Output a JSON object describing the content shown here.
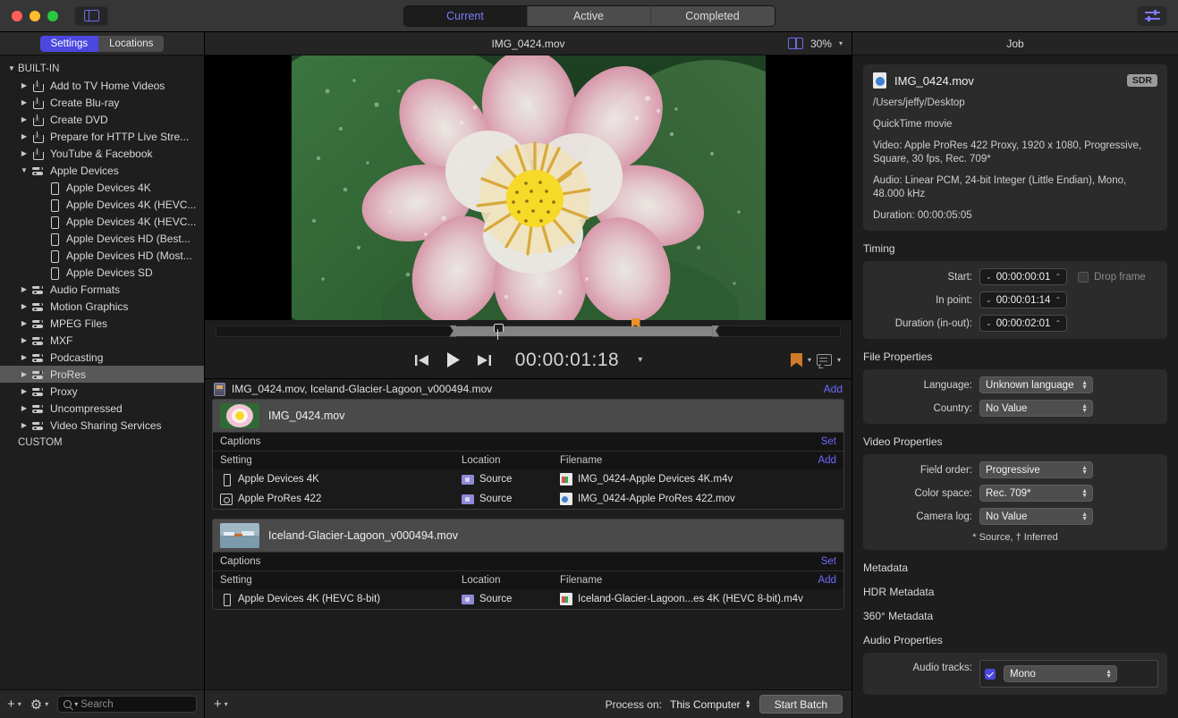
{
  "titlebar": {
    "sidebar_toggle_icon": "sidebar-panel-icon",
    "inspector_toggle_icon": "sliders-icon",
    "segments": [
      {
        "label": "Current",
        "active": true
      },
      {
        "label": "Active",
        "active": false
      },
      {
        "label": "Completed",
        "active": false
      }
    ]
  },
  "sidebar": {
    "tabs": [
      {
        "label": "Settings",
        "active": true
      },
      {
        "label": "Locations",
        "active": false
      }
    ],
    "tree": [
      {
        "label": "BUILT-IN",
        "level": 0,
        "twisty": "down",
        "icon": null,
        "selected": false
      },
      {
        "label": "Add to TV Home Videos",
        "level": 1,
        "twisty": "right",
        "icon": "share-icon",
        "selected": false
      },
      {
        "label": "Create Blu-ray",
        "level": 1,
        "twisty": "right",
        "icon": "share-icon",
        "selected": false
      },
      {
        "label": "Create DVD",
        "level": 1,
        "twisty": "right",
        "icon": "share-icon",
        "selected": false
      },
      {
        "label": "Prepare for HTTP Live Stre...",
        "level": 1,
        "twisty": "right",
        "icon": "share-icon",
        "selected": false
      },
      {
        "label": "YouTube & Facebook",
        "level": 1,
        "twisty": "right",
        "icon": "share-icon",
        "selected": false
      },
      {
        "label": "Apple Devices",
        "level": 1,
        "twisty": "down",
        "icon": "settings-group-icon",
        "selected": false
      },
      {
        "label": "Apple Devices 4K",
        "level": 2,
        "twisty": null,
        "icon": "device-icon",
        "selected": false
      },
      {
        "label": "Apple Devices 4K (HEVC...",
        "level": 2,
        "twisty": null,
        "icon": "device-icon",
        "selected": false
      },
      {
        "label": "Apple Devices 4K (HEVC...",
        "level": 2,
        "twisty": null,
        "icon": "device-icon",
        "selected": false
      },
      {
        "label": "Apple Devices HD (Best...",
        "level": 2,
        "twisty": null,
        "icon": "device-icon",
        "selected": false
      },
      {
        "label": "Apple Devices HD (Most...",
        "level": 2,
        "twisty": null,
        "icon": "device-icon",
        "selected": false
      },
      {
        "label": "Apple Devices SD",
        "level": 2,
        "twisty": null,
        "icon": "device-icon",
        "selected": false
      },
      {
        "label": "Audio Formats",
        "level": 1,
        "twisty": "right",
        "icon": "settings-group-icon",
        "selected": false
      },
      {
        "label": "Motion Graphics",
        "level": 1,
        "twisty": "right",
        "icon": "settings-group-icon",
        "selected": false
      },
      {
        "label": "MPEG Files",
        "level": 1,
        "twisty": "right",
        "icon": "settings-group-icon",
        "selected": false
      },
      {
        "label": "MXF",
        "level": 1,
        "twisty": "right",
        "icon": "settings-group-icon",
        "selected": false
      },
      {
        "label": "Podcasting",
        "level": 1,
        "twisty": "right",
        "icon": "settings-group-icon",
        "selected": false
      },
      {
        "label": "ProRes",
        "level": 1,
        "twisty": "right",
        "icon": "settings-group-icon",
        "selected": true
      },
      {
        "label": "Proxy",
        "level": 1,
        "twisty": "right",
        "icon": "settings-group-icon",
        "selected": false
      },
      {
        "label": "Uncompressed",
        "level": 1,
        "twisty": "right",
        "icon": "settings-group-icon",
        "selected": false
      },
      {
        "label": "Video Sharing Services",
        "level": 1,
        "twisty": "right",
        "icon": "settings-group-icon",
        "selected": false
      },
      {
        "label": "CUSTOM",
        "level": 0,
        "twisty": null,
        "icon": null,
        "selected": false
      }
    ],
    "footer": {
      "add_icon": "plus-icon",
      "gear_icon": "gear-icon",
      "search_placeholder": "Search",
      "search_value": ""
    }
  },
  "preview": {
    "title": "IMG_0424.mov",
    "split_icon": "split-view-icon",
    "zoom": "30%",
    "image_description": "pink lotus flower on green lily pads"
  },
  "transport": {
    "prev_icon": "skip-to-start-icon",
    "play_icon": "play-icon",
    "next_icon": "skip-to-end-icon",
    "timecode": "00:00:01:18",
    "marker_icon": "marker-bookmark-icon",
    "caption_icon": "caption-bubble-icon"
  },
  "batch": {
    "icon": "batch-icon",
    "title": "IMG_0424.mov, Iceland-Glacier-Lagoon_v000494.mov",
    "add_label": "Add",
    "columns": {
      "setting": "Setting",
      "location": "Location",
      "filename": "Filename"
    },
    "captions_label": "Captions",
    "captions_set_label": "Set",
    "row_add_label": "Add",
    "jobs": [
      {
        "name": "IMG_0424.mov",
        "thumb": "lotus-flower-thumb",
        "outputs": [
          {
            "setting": "Apple Devices 4K",
            "setting_icon": "device-icon",
            "location": "Source",
            "filename": "IMG_0424-Apple Devices 4K.m4v",
            "file_icon": "m4v-file-icon"
          },
          {
            "setting": "Apple ProRes 422",
            "setting_icon": "prores-icon",
            "location": "Source",
            "filename": "IMG_0424-Apple ProRes 422.mov",
            "file_icon": "mov-file-icon"
          }
        ]
      },
      {
        "name": "Iceland-Glacier-Lagoon_v000494.mov",
        "thumb": "glacier-lagoon-thumb",
        "outputs": [
          {
            "setting": "Apple Devices 4K (HEVC 8-bit)",
            "setting_icon": "device-icon",
            "location": "Source",
            "filename": "Iceland-Glacier-Lagoon...es 4K (HEVC 8-bit).m4v",
            "file_icon": "m4v-file-icon"
          }
        ]
      }
    ]
  },
  "batch_footer": {
    "add_icon": "plus-icon",
    "process_on_label": "Process on:",
    "process_on_value": "This Computer",
    "start_batch_label": "Start Batch"
  },
  "inspector": {
    "tab": "Job",
    "file": {
      "icon": "mov-file-icon",
      "name": "IMG_0424.mov",
      "badge": "SDR",
      "path": "/Users/jeffy/Desktop",
      "kind": "QuickTime movie",
      "video": "Video: Apple ProRes 422 Proxy, 1920 x 1080, Progressive, Square, 30 fps, Rec. 709*",
      "audio": "Audio: Linear PCM, 24-bit Integer (Little Endian), Mono, 48.000 kHz",
      "duration": "Duration: 00:00:05:05"
    },
    "timing": {
      "title": "Timing",
      "start_label": "Start:",
      "start_value": "00:00:00:01",
      "drop_frame_label": "Drop frame",
      "drop_frame_checked": false,
      "in_point_label": "In point:",
      "in_point_value": "00:00:01:14",
      "duration_label": "Duration (in-out):",
      "duration_value": "00:00:02:01"
    },
    "file_properties": {
      "title": "File Properties",
      "language_label": "Language:",
      "language_value": "Unknown language",
      "country_label": "Country:",
      "country_value": "No Value"
    },
    "video_properties": {
      "title": "Video Properties",
      "field_order_label": "Field order:",
      "field_order_value": "Progressive",
      "color_space_label": "Color space:",
      "color_space_value": "Rec. 709*",
      "camera_log_label": "Camera log:",
      "camera_log_value": "No Value",
      "footnote": "* Source, † Inferred"
    },
    "collapsed_sections": [
      "Metadata",
      "HDR Metadata",
      "360° Metadata"
    ],
    "audio_properties": {
      "title": "Audio Properties",
      "audio_tracks_label": "Audio tracks:",
      "track_checked": true,
      "track_value": "Mono"
    }
  },
  "colors": {
    "accent": "#4b48e0",
    "link": "#6e6aff",
    "marker": "#e8922e",
    "selection": "#585858"
  }
}
